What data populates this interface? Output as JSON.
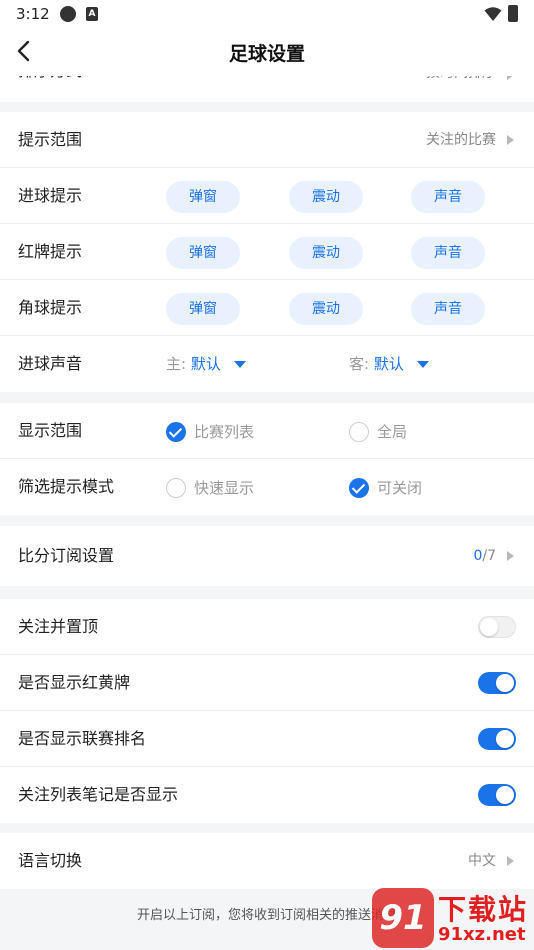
{
  "status_bar": {
    "time": "3:12",
    "icon_a_label": "A",
    "icons": [
      "settings-app-icon",
      "a-app-icon",
      "wifi-icon",
      "battery-icon"
    ]
  },
  "header": {
    "title": "足球设置",
    "back_icon": "chevron-left-icon"
  },
  "top_row": {
    "label": "排序方式",
    "value": "按时间排序"
  },
  "alerts": {
    "scope": {
      "label": "提示范围",
      "value": "关注的比赛"
    },
    "goal": {
      "label": "进球提示",
      "options": [
        "弹窗",
        "震动",
        "声音"
      ]
    },
    "red_card": {
      "label": "红牌提示",
      "options": [
        "弹窗",
        "震动",
        "声音"
      ]
    },
    "corner": {
      "label": "角球提示",
      "options": [
        "弹窗",
        "震动",
        "声音"
      ]
    },
    "goal_sound": {
      "label": "进球声音",
      "home_prefix": "主:",
      "home_value": "默认",
      "away_prefix": "客:",
      "away_value": "默认"
    }
  },
  "display": {
    "scope": {
      "label": "显示范围",
      "option_a": "比赛列表",
      "option_a_checked": true,
      "option_b": "全局",
      "option_b_checked": false
    },
    "filter_mode": {
      "label": "筛选提示模式",
      "option_a": "快速显示",
      "option_a_checked": false,
      "option_b": "可关闭",
      "option_b_checked": true
    }
  },
  "score_sub": {
    "label": "比分订阅设置",
    "current": "0",
    "total": "/7"
  },
  "toggles": [
    {
      "label": "关注并置顶",
      "on": false
    },
    {
      "label": "是否显示红黄牌",
      "on": true
    },
    {
      "label": "是否显示联赛排名",
      "on": true
    },
    {
      "label": "关注列表笔记是否显示",
      "on": true
    }
  ],
  "language": {
    "label": "语言切换",
    "value": "中文"
  },
  "footer": {
    "note": "开启以上订阅，您将收到订阅相关的推送消息"
  },
  "watermark": {
    "logo": "91",
    "title": "下载站",
    "url": "91xz.net"
  },
  "colors": {
    "accent": "#1a73e8",
    "pill_bg": "#e8f1fd",
    "page_bg": "#f4f5f7",
    "watermark": "#e02020"
  }
}
